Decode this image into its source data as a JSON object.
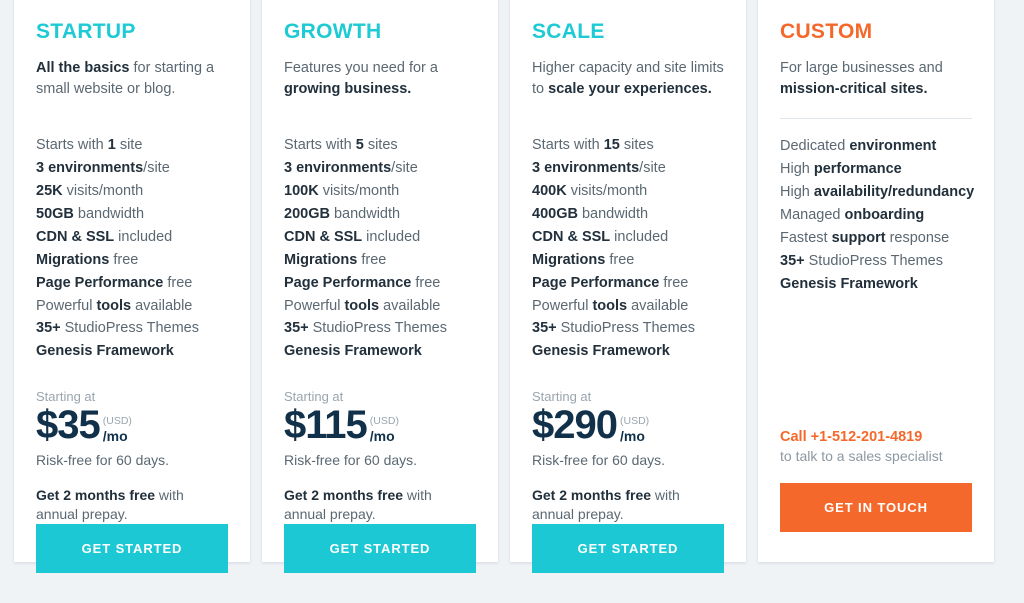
{
  "theme": {
    "page_background": "#f0f3f6",
    "card_background": "#ffffff",
    "accent_cyan": "#1cc8d4",
    "accent_orange": "#f4692b",
    "price_navy": "#11314a",
    "body_gray": "#5b6872"
  },
  "plans": [
    {
      "title": "STARTUP",
      "tagline_bold": "All the basics",
      "tagline_rest": " for starting a small website or blog.",
      "features": [
        {
          "pre": "Starts with ",
          "bold": "1",
          "post": " site"
        },
        {
          "pre": "",
          "bold": "3 environments",
          "post": "/site"
        },
        {
          "pre": "",
          "bold": "25K",
          "post": " visits/month"
        },
        {
          "pre": "",
          "bold": "50GB",
          "post": " bandwidth"
        },
        {
          "pre": "",
          "bold": "CDN & SSL",
          "post": " included"
        },
        {
          "pre": "",
          "bold": "Migrations",
          "post": " free"
        },
        {
          "pre": "",
          "bold": "Page Performance",
          "post": " free"
        },
        {
          "pre": "Powerful ",
          "bold": "tools",
          "post": " available"
        },
        {
          "pre": "",
          "bold": "35+",
          "post": " StudioPress Themes"
        },
        {
          "pre": "",
          "bold": "Genesis Framework",
          "post": ""
        }
      ],
      "starting_at": "Starting at",
      "price": "$35",
      "currency": "(USD)",
      "period": "/mo",
      "risk_free": "Risk-free for 60 days.",
      "annual_bold": "Get 2 months free",
      "annual_rest": " with annual prepay.",
      "cta_label": "GET STARTED"
    },
    {
      "title": "GROWTH",
      "tagline_bold": "",
      "tagline_rest": "Features you need for a ",
      "tagline_bold_end": "growing business.",
      "features": [
        {
          "pre": "Starts with ",
          "bold": "5",
          "post": " sites"
        },
        {
          "pre": "",
          "bold": "3 environments",
          "post": "/site"
        },
        {
          "pre": "",
          "bold": "100K",
          "post": " visits/month"
        },
        {
          "pre": "",
          "bold": "200GB",
          "post": " bandwidth"
        },
        {
          "pre": "",
          "bold": "CDN & SSL",
          "post": " included"
        },
        {
          "pre": "",
          "bold": "Migrations",
          "post": " free"
        },
        {
          "pre": "",
          "bold": "Page Performance",
          "post": " free"
        },
        {
          "pre": "Powerful ",
          "bold": "tools",
          "post": " available"
        },
        {
          "pre": "",
          "bold": "35+",
          "post": " StudioPress Themes"
        },
        {
          "pre": "",
          "bold": "Genesis Framework",
          "post": ""
        }
      ],
      "starting_at": "Starting at",
      "price": "$115",
      "currency": "(USD)",
      "period": "/mo",
      "risk_free": "Risk-free for 60 days.",
      "annual_bold": "Get 2 months free",
      "annual_rest": " with annual prepay.",
      "cta_label": "GET STARTED"
    },
    {
      "title": "SCALE",
      "tagline_bold": "",
      "tagline_rest": "Higher capacity and site limits to ",
      "tagline_bold_end": "scale your experiences.",
      "features": [
        {
          "pre": "Starts with ",
          "bold": "15",
          "post": " sites"
        },
        {
          "pre": "",
          "bold": "3 environments",
          "post": "/site"
        },
        {
          "pre": "",
          "bold": "400K",
          "post": " visits/month"
        },
        {
          "pre": "",
          "bold": "400GB",
          "post": " bandwidth"
        },
        {
          "pre": "",
          "bold": "CDN & SSL",
          "post": " included"
        },
        {
          "pre": "",
          "bold": "Migrations",
          "post": " free"
        },
        {
          "pre": "",
          "bold": "Page Performance",
          "post": " free"
        },
        {
          "pre": "Powerful ",
          "bold": "tools",
          "post": " available"
        },
        {
          "pre": "",
          "bold": "35+",
          "post": " StudioPress Themes"
        },
        {
          "pre": "",
          "bold": "Genesis Framework",
          "post": ""
        }
      ],
      "starting_at": "Starting at",
      "price": "$290",
      "currency": "(USD)",
      "period": "/mo",
      "risk_free": "Risk-free for 60 days.",
      "annual_bold": "Get 2 months free",
      "annual_rest": " with annual prepay.",
      "cta_label": "GET STARTED"
    },
    {
      "title": "CUSTOM",
      "tagline_bold": "",
      "tagline_rest": "For large businesses and ",
      "tagline_bold_end": "mission-critical sites.",
      "features": [
        {
          "pre": "Dedicated ",
          "bold": "environment",
          "post": ""
        },
        {
          "pre": "High ",
          "bold": "performance",
          "post": ""
        },
        {
          "pre": "High ",
          "bold": "availability/redundancy",
          "post": ""
        },
        {
          "pre": "Managed ",
          "bold": "onboarding",
          "post": ""
        },
        {
          "pre": "Fastest ",
          "bold": "support",
          "post": " response"
        },
        {
          "pre": "",
          "bold": "35+",
          "post": " StudioPress Themes"
        },
        {
          "pre": "",
          "bold": "Genesis Framework",
          "post": ""
        }
      ],
      "contact_phone": "Call +1-512-201-4819",
      "contact_sub": "to talk to a sales specialist",
      "cta_label": "GET IN TOUCH"
    }
  ]
}
